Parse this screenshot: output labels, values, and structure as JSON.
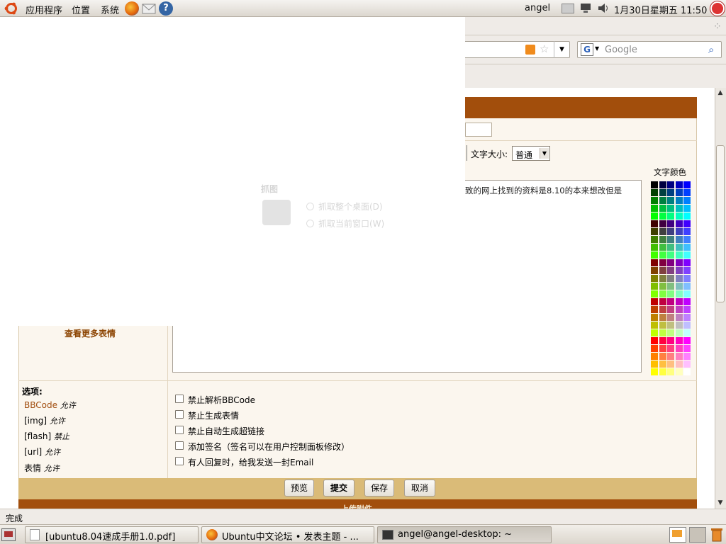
{
  "top_panel": {
    "menus": [
      "应用程序",
      "位置",
      "系统"
    ],
    "user": "angel",
    "datetime": "1月30日星期五 11:50"
  },
  "browser": {
    "search_placeholder": "Google",
    "status": "完成"
  },
  "editor": {
    "font_size_label": "文字大小:",
    "font_size_value": "普通",
    "textarea_content": "致的网上找到的资料是8.10的本来想改但是",
    "color_label": "文字颜色",
    "more_emoticons": "查看更多表情"
  },
  "options": {
    "title": "选项:",
    "left": [
      {
        "name": "BBCode",
        "status": "允许"
      },
      {
        "name": "[img]",
        "status": "允许"
      },
      {
        "name": "[flash]",
        "status": "禁止"
      },
      {
        "name": "[url]",
        "status": "允许"
      },
      {
        "name": "表情",
        "status": "允许"
      }
    ],
    "checkboxes": [
      "禁止解析BBCode",
      "禁止生成表情",
      "禁止自动生成超链接",
      "添加签名（签名可以在用户控制面板修改）",
      "有人回复时，给我发送一封Email"
    ]
  },
  "buttons": {
    "preview": "预览",
    "submit": "提交",
    "save": "保存",
    "cancel": "取消"
  },
  "bottom_header": "上传附件",
  "taskbar": [
    "[ubuntu8.04速成手册1.0.pdf]",
    "Ubuntu中文论坛 • 发表主题 - ...",
    "angel@angel-desktop: ~"
  ],
  "ghost_dialog": {
    "title": "抓图",
    "option1": "抓取整个桌面(D)",
    "option2": "抓取当前窗口(W)"
  },
  "colors": {
    "header_brown": "#a24e0c",
    "button_bar": "#dabb78",
    "panel_bg": "#fbf6ee"
  }
}
